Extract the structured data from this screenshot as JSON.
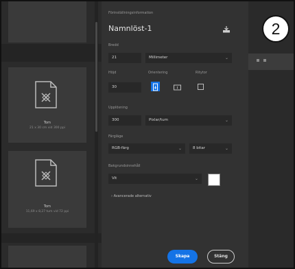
{
  "step_number": "2",
  "library": {
    "cards": [
      {
        "title": "Tom",
        "subtitle": "21 x 30 cm vid 300 ppi"
      },
      {
        "title": "Tom",
        "subtitle": "11,69 x 8,27 tum vid 72 ppi"
      }
    ]
  },
  "dialog": {
    "header_label": "Förinställningsinformation",
    "document_name": "Namnlöst-1",
    "width_label": "Bredd",
    "width_value": "21",
    "width_unit": "Millimeter",
    "height_label": "Höjd",
    "height_value": "30",
    "orientation_label": "Orientering",
    "artboards_label": "Ritytor",
    "resolution_label": "Upplösning",
    "resolution_value": "300",
    "resolution_unit": "Pixlar/tum",
    "color_mode_label": "Färgläge",
    "color_mode_value": "RGB-färg",
    "bit_depth_value": "8 bitar",
    "background_label": "Bakgrundsinnehåll",
    "background_value": "Vit",
    "advanced_label": "Avancerade alternativ",
    "create_button": "Skapa",
    "close_button": "Stäng"
  },
  "colors": {
    "accent": "#1473e6",
    "background_swatch": "#ffffff"
  }
}
